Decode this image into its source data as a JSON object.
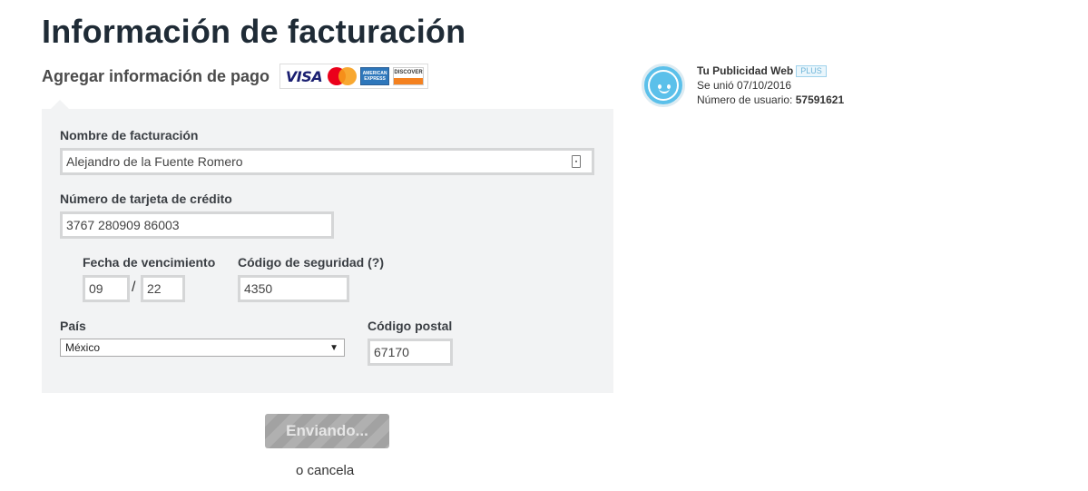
{
  "page": {
    "title": "Información de facturación",
    "subtitle": "Agregar información de pago"
  },
  "card_logos": {
    "visa": "VISA",
    "mastercard": "MasterCard",
    "amex": "AMERICAN EXPRESS",
    "discover": "DISCOVER"
  },
  "form": {
    "billing_name_label": "Nombre de facturación",
    "billing_name_value": "Alejandro de la Fuente Romero",
    "card_number_label": "Número de tarjeta de crédito",
    "card_number_value": "3767 280909 86003",
    "expiry_label": "Fecha de vencimiento",
    "expiry_month": "09",
    "expiry_separator": "/",
    "expiry_year": "22",
    "security_label": "Código de seguridad",
    "security_help": "(?)",
    "security_value": "4350",
    "country_label": "País",
    "country_value": "México",
    "postal_label": "Código postal",
    "postal_value": "67170"
  },
  "actions": {
    "submit_label": "Enviando...",
    "cancel_label": "o cancela"
  },
  "profile": {
    "name": "Tu Publicidad Web",
    "badge": "PLUS",
    "joined": "Se unió 07/10/2016",
    "user_number_label": "Número de usuario:",
    "user_number": "57591621"
  },
  "colors": {
    "form_background": "#f2f3f4",
    "avatar_blue": "#5bc0ea",
    "button_gray": "#b0b0b0"
  }
}
